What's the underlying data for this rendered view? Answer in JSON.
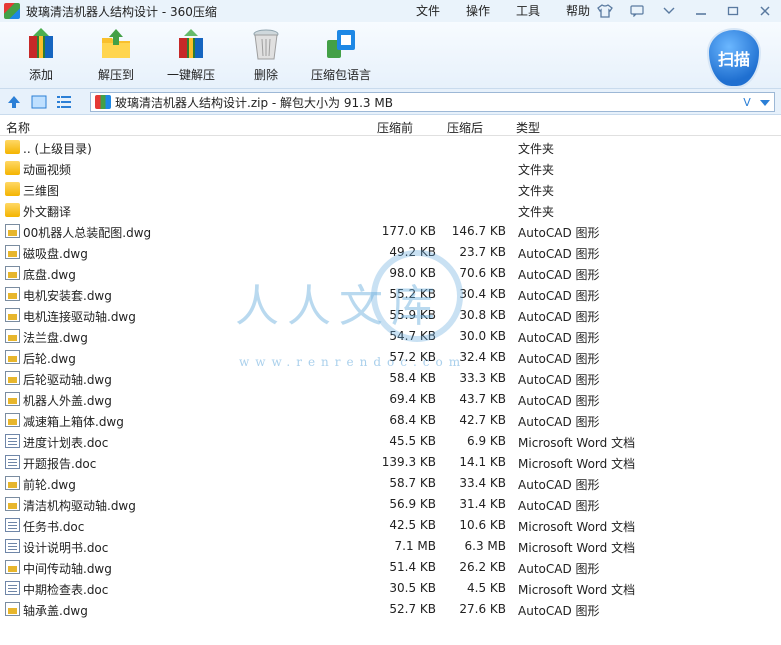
{
  "window": {
    "title": "玻璃清洁机器人结构设计 - 360压缩",
    "menus": [
      "文件",
      "操作",
      "工具",
      "帮助"
    ]
  },
  "toolbar": {
    "buttons": [
      {
        "label": "添加",
        "icon": "add-archive-icon"
      },
      {
        "label": "解压到",
        "icon": "extract-to-icon"
      },
      {
        "label": "一键解压",
        "icon": "one-click-extract-icon"
      },
      {
        "label": "删除",
        "icon": "delete-icon"
      },
      {
        "label": "压缩包语言",
        "icon": "archive-language-icon"
      }
    ],
    "scan_label": "扫描"
  },
  "address": {
    "path": "玻璃清洁机器人结构设计.zip - 解包大小为 91.3 MB",
    "dropdown_glyph": "V"
  },
  "columns": {
    "name": "名称",
    "before": "压缩前",
    "after": "压缩后",
    "type": "类型"
  },
  "files": [
    {
      "name": ".. (上级目录)",
      "before": "",
      "after": "",
      "type": "文件夹",
      "kind": "folder"
    },
    {
      "name": "动画视频",
      "before": "",
      "after": "",
      "type": "文件夹",
      "kind": "folder"
    },
    {
      "name": "三维图",
      "before": "",
      "after": "",
      "type": "文件夹",
      "kind": "folder"
    },
    {
      "name": "外文翻译",
      "before": "",
      "after": "",
      "type": "文件夹",
      "kind": "folder"
    },
    {
      "name": "00机器人总装配图.dwg",
      "before": "177.0 KB",
      "after": "146.7 KB",
      "type": "AutoCAD 图形",
      "kind": "dwg"
    },
    {
      "name": "磁吸盘.dwg",
      "before": "49.2 KB",
      "after": "23.7 KB",
      "type": "AutoCAD 图形",
      "kind": "dwg"
    },
    {
      "name": "底盘.dwg",
      "before": "98.0 KB",
      "after": "70.6 KB",
      "type": "AutoCAD 图形",
      "kind": "dwg"
    },
    {
      "name": "电机安装套.dwg",
      "before": "55.2 KB",
      "after": "30.4 KB",
      "type": "AutoCAD 图形",
      "kind": "dwg"
    },
    {
      "name": "电机连接驱动轴.dwg",
      "before": "55.9 KB",
      "after": "30.8 KB",
      "type": "AutoCAD 图形",
      "kind": "dwg"
    },
    {
      "name": "法兰盘.dwg",
      "before": "54.7 KB",
      "after": "30.0 KB",
      "type": "AutoCAD 图形",
      "kind": "dwg"
    },
    {
      "name": "后轮.dwg",
      "before": "57.2 KB",
      "after": "32.4 KB",
      "type": "AutoCAD 图形",
      "kind": "dwg"
    },
    {
      "name": "后轮驱动轴.dwg",
      "before": "58.4 KB",
      "after": "33.3 KB",
      "type": "AutoCAD 图形",
      "kind": "dwg"
    },
    {
      "name": "机器人外盖.dwg",
      "before": "69.4 KB",
      "after": "43.7 KB",
      "type": "AutoCAD 图形",
      "kind": "dwg"
    },
    {
      "name": "减速箱上箱体.dwg",
      "before": "68.4 KB",
      "after": "42.7 KB",
      "type": "AutoCAD 图形",
      "kind": "dwg"
    },
    {
      "name": "进度计划表.doc",
      "before": "45.5 KB",
      "after": "6.9 KB",
      "type": "Microsoft Word 文档",
      "kind": "doc"
    },
    {
      "name": "开题报告.doc",
      "before": "139.3 KB",
      "after": "14.1 KB",
      "type": "Microsoft Word 文档",
      "kind": "doc"
    },
    {
      "name": "前轮.dwg",
      "before": "58.7 KB",
      "after": "33.4 KB",
      "type": "AutoCAD 图形",
      "kind": "dwg"
    },
    {
      "name": "清洁机构驱动轴.dwg",
      "before": "56.9 KB",
      "after": "31.4 KB",
      "type": "AutoCAD 图形",
      "kind": "dwg"
    },
    {
      "name": "任务书.doc",
      "before": "42.5 KB",
      "after": "10.6 KB",
      "type": "Microsoft Word 文档",
      "kind": "doc"
    },
    {
      "name": "设计说明书.doc",
      "before": "7.1 MB",
      "after": "6.3 MB",
      "type": "Microsoft Word 文档",
      "kind": "doc"
    },
    {
      "name": "中间传动轴.dwg",
      "before": "51.4 KB",
      "after": "26.2 KB",
      "type": "AutoCAD 图形",
      "kind": "dwg"
    },
    {
      "name": "中期检查表.doc",
      "before": "30.5 KB",
      "after": "4.5 KB",
      "type": "Microsoft Word 文档",
      "kind": "doc"
    },
    {
      "name": "轴承盖.dwg",
      "before": "52.7 KB",
      "after": "27.6 KB",
      "type": "AutoCAD 图形",
      "kind": "dwg"
    }
  ],
  "watermark": {
    "text": "人人文库",
    "url": "www.renrendoc.com"
  }
}
